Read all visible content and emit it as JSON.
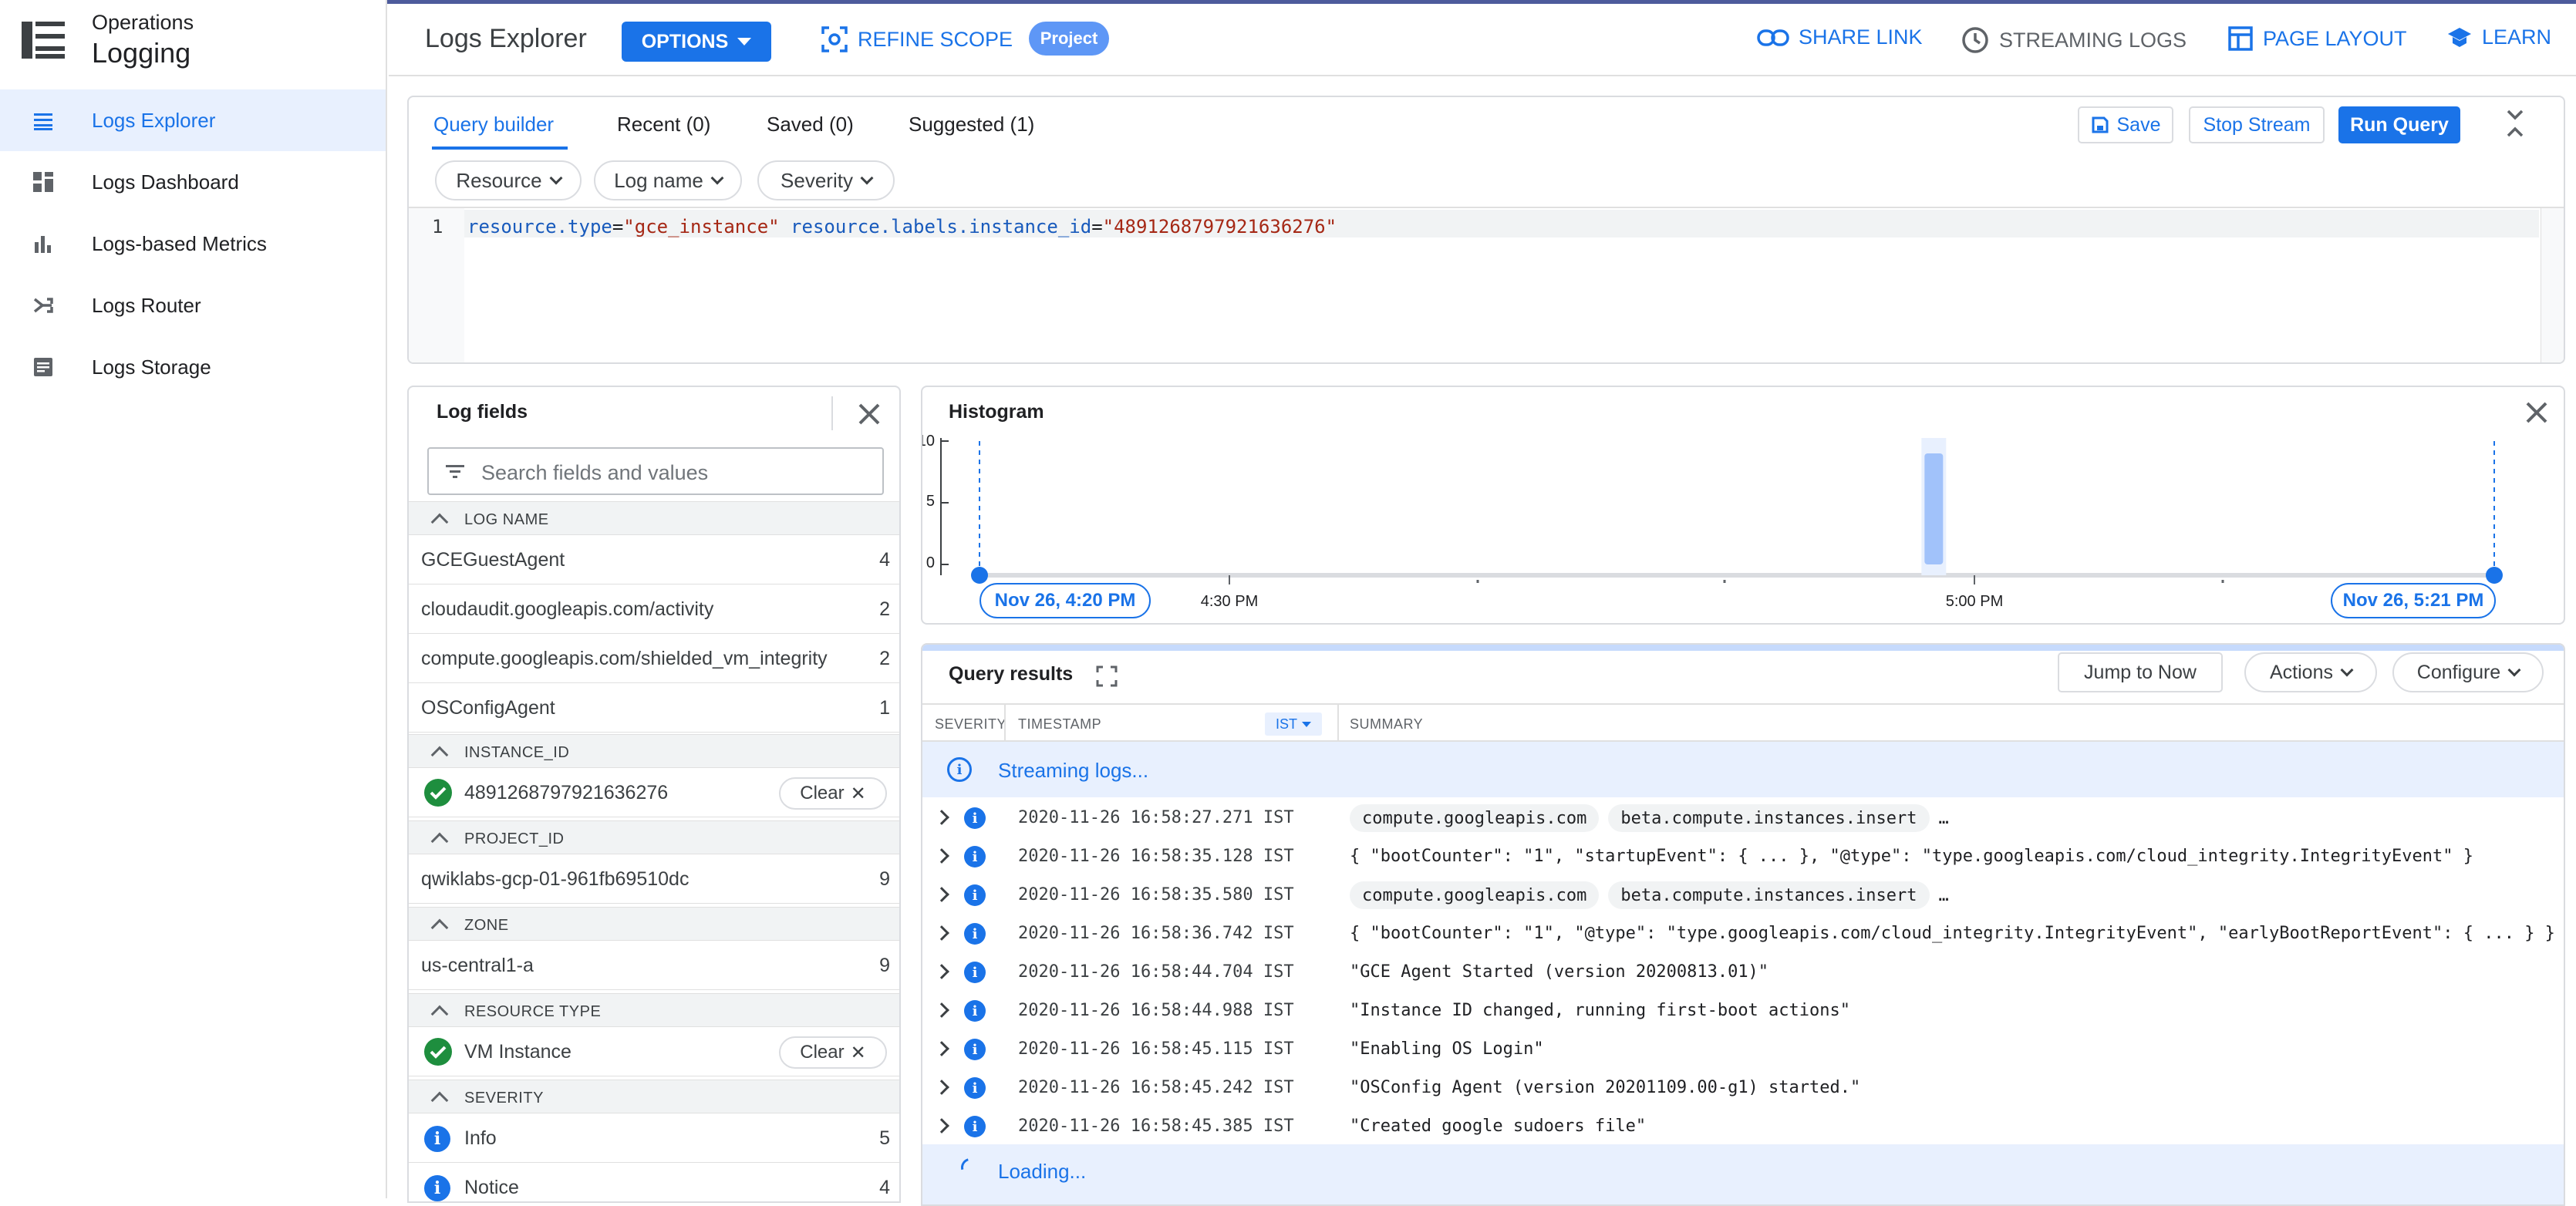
{
  "app": {
    "subtitle": "Operations",
    "title": "Logging"
  },
  "sidebar": {
    "items": [
      {
        "label": "Logs Explorer",
        "icon": "list-icon"
      },
      {
        "label": "Logs Dashboard",
        "icon": "dashboard-icon"
      },
      {
        "label": "Logs-based Metrics",
        "icon": "bar-chart-icon"
      },
      {
        "label": "Logs Router",
        "icon": "router-icon"
      },
      {
        "label": "Logs Storage",
        "icon": "storage-icon"
      }
    ],
    "active_index": 0
  },
  "header": {
    "title": "Logs Explorer",
    "options_label": "OPTIONS",
    "refine_scope_label": "REFINE SCOPE",
    "project_chip": "Project",
    "share_link_label": "SHARE LINK",
    "streaming_logs_label": "STREAMING LOGS",
    "page_layout_label": "PAGE LAYOUT",
    "learn_label": "LEARN"
  },
  "query": {
    "tabs": [
      "Query builder",
      "Recent (0)",
      "Saved (0)",
      "Suggested (1)"
    ],
    "active_tab": 0,
    "save_label": "Save",
    "stop_stream_label": "Stop Stream",
    "run_query_label": "Run Query",
    "filters": [
      "Resource",
      "Log name",
      "Severity"
    ],
    "line_number": "1",
    "code": {
      "k1": "resource.type",
      "eq1": "=",
      "v1": "\"gce_instance\"",
      "k2": "resource.labels.instance_id",
      "eq2": "=",
      "v2": "\"4891268797921636276\""
    }
  },
  "log_fields": {
    "title": "Log fields",
    "search_placeholder": "Search fields and values",
    "clear_label": "Clear",
    "sections": {
      "log_name": "LOG NAME",
      "instance_id": "INSTANCE_ID",
      "project_id": "PROJECT_ID",
      "zone": "ZONE",
      "resource_type": "RESOURCE TYPE",
      "severity": "SEVERITY"
    },
    "log_names": [
      {
        "name": "GCEGuestAgent",
        "count": "4"
      },
      {
        "name": "cloudaudit.googleapis.com/activity",
        "count": "2"
      },
      {
        "name": "compute.googleapis.com/shielded_vm_integrity",
        "count": "2"
      },
      {
        "name": "OSConfigAgent",
        "count": "1"
      }
    ],
    "instance_id_value": "4891268797921636276",
    "project_id": {
      "name": "qwiklabs-gcp-01-961fb69510dc",
      "count": "9"
    },
    "zone": {
      "name": "us-central1-a",
      "count": "9"
    },
    "resource_type_value": "VM Instance",
    "severities": [
      {
        "name": "Info",
        "count": "5"
      },
      {
        "name": "Notice",
        "count": "4"
      }
    ]
  },
  "histogram": {
    "title": "Histogram",
    "y_ticks": [
      "10",
      "5",
      "0"
    ],
    "x_ticks": [
      "4:30 PM",
      "5:00 PM"
    ],
    "range_start": "Nov 26, 4:20 PM",
    "range_end": "Nov 26, 5:21 PM",
    "bar_position": 0.63,
    "bar_value": 9,
    "y_max": 10
  },
  "results": {
    "title": "Query results",
    "jump_label": "Jump to Now",
    "actions_label": "Actions",
    "configure_label": "Configure",
    "columns": {
      "severity": "SEVERITY",
      "timestamp": "TIMESTAMP",
      "tz": "IST",
      "summary": "SUMMARY"
    },
    "streaming_text": "Streaming logs...",
    "loading_text": "Loading...",
    "rows": [
      {
        "ts": "2020-11-26 16:58:27.271 IST",
        "chips": [
          "compute.googleapis.com",
          "beta.compute.instances.insert"
        ],
        "ellipsis": "…",
        "summary": ""
      },
      {
        "ts": "2020-11-26 16:58:35.128 IST",
        "chips": [],
        "summary": "{ \"bootCounter\": \"1\", \"startupEvent\": { ... }, \"@type\": \"type.googleapis.com/cloud_integrity.IntegrityEvent\" }"
      },
      {
        "ts": "2020-11-26 16:58:35.580 IST",
        "chips": [
          "compute.googleapis.com",
          "beta.compute.instances.insert"
        ],
        "ellipsis": "…",
        "summary": ""
      },
      {
        "ts": "2020-11-26 16:58:36.742 IST",
        "chips": [],
        "summary": "{ \"bootCounter\": \"1\", \"@type\": \"type.googleapis.com/cloud_integrity.IntegrityEvent\", \"earlyBootReportEvent\": { ... } }"
      },
      {
        "ts": "2020-11-26 16:58:44.704 IST",
        "chips": [],
        "summary": "\"GCE Agent Started (version 20200813.01)\""
      },
      {
        "ts": "2020-11-26 16:58:44.988 IST",
        "chips": [],
        "summary": "\"Instance ID changed, running first-boot actions\""
      },
      {
        "ts": "2020-11-26 16:58:45.115 IST",
        "chips": [],
        "summary": "\"Enabling OS Login\""
      },
      {
        "ts": "2020-11-26 16:58:45.242 IST",
        "chips": [],
        "summary": "\"OSConfig Agent (version 20201109.00-g1) started.\""
      },
      {
        "ts": "2020-11-26 16:58:45.385 IST",
        "chips": [],
        "summary": "\"Created google sudoers file\""
      }
    ]
  },
  "colors": {
    "accent": "#1a73e8",
    "success": "#1e8e3e",
    "brand_bar": "#4d5b9c"
  }
}
